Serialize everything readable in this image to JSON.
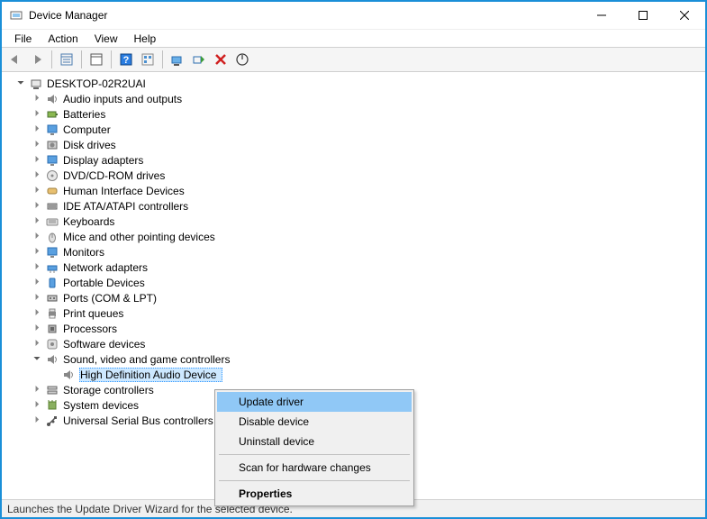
{
  "window": {
    "title": "Device Manager"
  },
  "menubar": [
    "File",
    "Action",
    "View",
    "Help"
  ],
  "status": "Launches the Update Driver Wizard for the selected device.",
  "root": {
    "name": "DESKTOP-02R2UAI"
  },
  "categories": [
    {
      "name": "Audio inputs and outputs",
      "icon": "speaker"
    },
    {
      "name": "Batteries",
      "icon": "battery"
    },
    {
      "name": "Computer",
      "icon": "monitor"
    },
    {
      "name": "Disk drives",
      "icon": "disk"
    },
    {
      "name": "Display adapters",
      "icon": "monitor"
    },
    {
      "name": "DVD/CD-ROM drives",
      "icon": "optical"
    },
    {
      "name": "Human Interface Devices",
      "icon": "hid"
    },
    {
      "name": "IDE ATA/ATAPI controllers",
      "icon": "ide"
    },
    {
      "name": "Keyboards",
      "icon": "keyboard"
    },
    {
      "name": "Mice and other pointing devices",
      "icon": "mouse"
    },
    {
      "name": "Monitors",
      "icon": "monitor"
    },
    {
      "name": "Network adapters",
      "icon": "network"
    },
    {
      "name": "Portable Devices",
      "icon": "portable"
    },
    {
      "name": "Ports (COM & LPT)",
      "icon": "port"
    },
    {
      "name": "Print queues",
      "icon": "printer"
    },
    {
      "name": "Processors",
      "icon": "cpu"
    },
    {
      "name": "Software devices",
      "icon": "software"
    },
    {
      "name": "Sound, video and game controllers",
      "icon": "speaker",
      "expanded": true,
      "children": [
        {
          "name": "High Definition Audio Device",
          "icon": "speaker",
          "selected": true
        }
      ]
    },
    {
      "name": "Storage controllers",
      "icon": "storage"
    },
    {
      "name": "System devices",
      "icon": "system"
    },
    {
      "name": "Universal Serial Bus controllers",
      "icon": "usb"
    }
  ],
  "context_menu": {
    "items": [
      {
        "label": "Update driver",
        "highlighted": true
      },
      {
        "label": "Disable device"
      },
      {
        "label": "Uninstall device"
      },
      {
        "sep": true
      },
      {
        "label": "Scan for hardware changes"
      },
      {
        "sep": true
      },
      {
        "label": "Properties",
        "bold": true
      }
    ]
  }
}
